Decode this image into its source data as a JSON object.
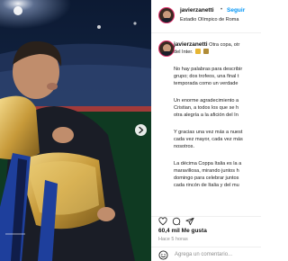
{
  "post": {
    "username": "javierzanetti",
    "location": "Estadio Olímpico de Roma",
    "follow_label": "Seguir",
    "separator": "•"
  },
  "caption": {
    "username": "javierzanetti",
    "lines": [
      "Otra copa, otr",
      "del Inter.",
      "",
      "No hay palabras para describir",
      "grupo; dos trofeos, una final t",
      "temporada como un verdade",
      "",
      "Un enorme agradecimiento a",
      "Cristian, a todos los que se h",
      "otra alegría a la afición del In",
      "",
      "Y gracias una vez más a nuest",
      "cada vez mayor, cada vez más",
      "nosotros.",
      "",
      "La décima Coppa Italia es la a",
      "maravillosa, mirando juntos h",
      "domingo para celebrar juntos",
      "cada rincón de Italia y del mu"
    ]
  },
  "actions": {
    "likes": "60,4 mil Me gusta",
    "time": "Hace 5 horas",
    "comment_placeholder": "Agrega un comentario..."
  },
  "icons": {
    "like": "heart-icon",
    "comment": "comment-icon",
    "share": "send-icon",
    "emoji": "smiley-icon"
  },
  "colors": {
    "accent": "#0095f6",
    "muted": "#8e8e8e"
  }
}
